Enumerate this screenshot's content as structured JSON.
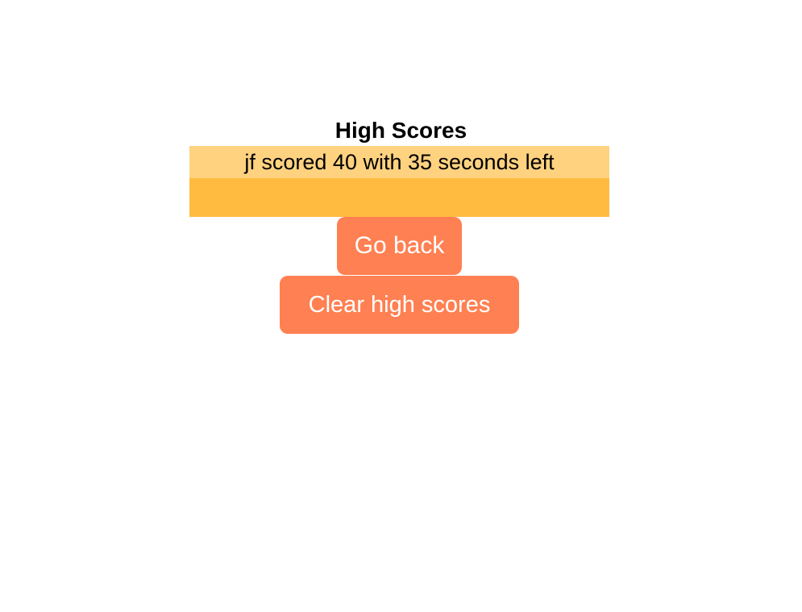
{
  "title": "High Scores",
  "scores": [
    {
      "text": "jf scored 40 with 35 seconds left"
    }
  ],
  "buttons": {
    "go_back": "Go back",
    "clear": "Clear high scores"
  },
  "colors": {
    "list_bg": "#ffbb40",
    "item_bg": "#ffd280",
    "button_bg": "#ff8052"
  }
}
